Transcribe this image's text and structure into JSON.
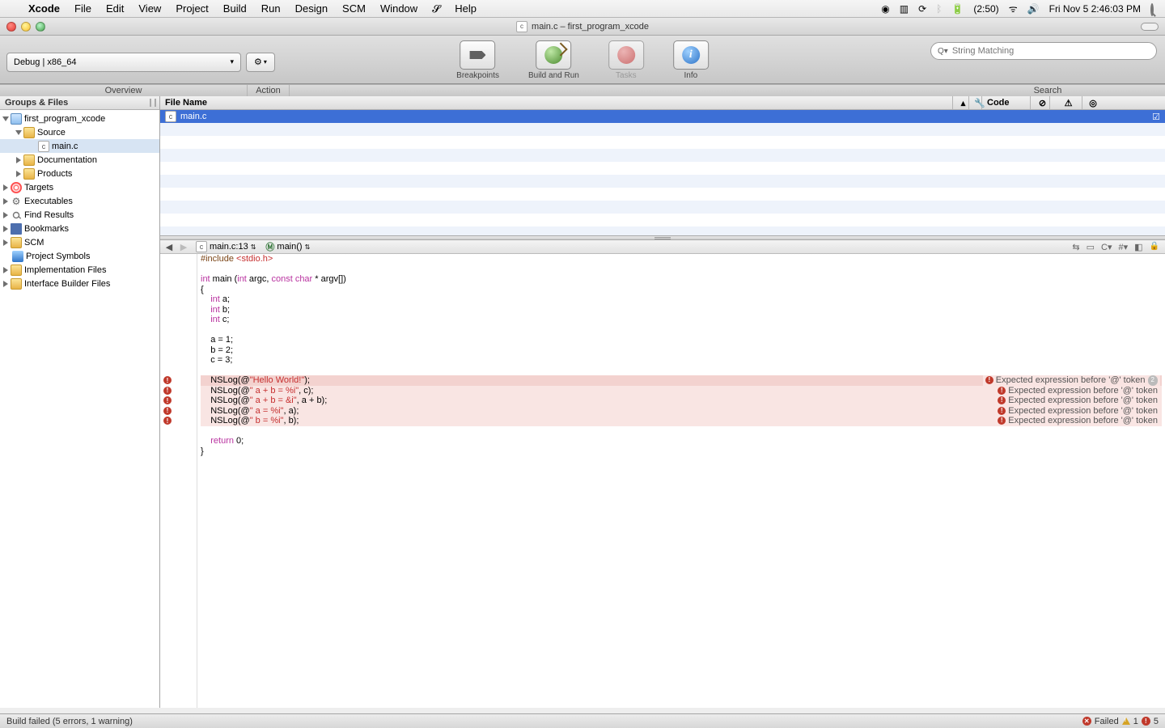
{
  "menubar": {
    "app": "Xcode",
    "items": [
      "File",
      "Edit",
      "View",
      "Project",
      "Build",
      "Run",
      "Design",
      "SCM",
      "Window"
    ],
    "help": "Help",
    "battery": "(2:50)",
    "datetime": "Fri Nov 5  2:46:03 PM"
  },
  "window": {
    "title": "main.c – first_program_xcode",
    "file_icon_letter": "c"
  },
  "toolbar": {
    "config": "Debug | x86_64",
    "overview": "Overview",
    "action": "Action",
    "breakpoints": "Breakpoints",
    "build_run": "Build and Run",
    "tasks": "Tasks",
    "info": "Info",
    "search_label": "Search",
    "search_placeholder": "String Matching"
  },
  "sidebar": {
    "header": "Groups & Files",
    "nodes": [
      {
        "indent": 0,
        "tri": "open",
        "icon": "proj",
        "label": "first_program_xcode"
      },
      {
        "indent": 1,
        "tri": "open",
        "icon": "folder",
        "label": "Source"
      },
      {
        "indent": 2,
        "tri": "none",
        "icon": "cfile",
        "label": "main.c",
        "selected": true,
        "icon_letter": "c"
      },
      {
        "indent": 1,
        "tri": "closed",
        "icon": "folder",
        "label": "Documentation"
      },
      {
        "indent": 1,
        "tri": "closed",
        "icon": "folder",
        "label": "Products"
      },
      {
        "indent": 0,
        "tri": "closed",
        "icon": "target",
        "label": "Targets"
      },
      {
        "indent": 0,
        "tri": "closed",
        "icon": "gear2",
        "label": "Executables"
      },
      {
        "indent": 0,
        "tri": "closed",
        "icon": "mag",
        "label": "Find Results"
      },
      {
        "indent": 0,
        "tri": "closed",
        "icon": "book",
        "label": "Bookmarks"
      },
      {
        "indent": 0,
        "tri": "closed",
        "icon": "folder",
        "label": "SCM"
      },
      {
        "indent": 0,
        "tri": "none",
        "icon": "cube",
        "label": "Project Symbols"
      },
      {
        "indent": 0,
        "tri": "closed",
        "icon": "folder",
        "label": "Implementation Files"
      },
      {
        "indent": 0,
        "tri": "closed",
        "icon": "folder",
        "label": "Interface Builder Files"
      }
    ]
  },
  "file_list": {
    "columns": {
      "name": "File Name",
      "code": "Code"
    },
    "rows": [
      {
        "icon_letter": "c",
        "name": "main.c",
        "selected": true
      }
    ]
  },
  "nav": {
    "file": "main.c:13",
    "func": "main()"
  },
  "code": {
    "lines": [
      {
        "t": "pp",
        "c": "#include <stdio.h>"
      },
      {
        "t": "",
        "c": ""
      },
      {
        "t": "sig",
        "c": "int main (int argc, const char * argv[])"
      },
      {
        "t": "",
        "c": "{"
      },
      {
        "t": "decl",
        "c": "    int a;"
      },
      {
        "t": "decl",
        "c": "    int b;"
      },
      {
        "t": "decl",
        "c": "    int c;"
      },
      {
        "t": "",
        "c": "    "
      },
      {
        "t": "",
        "c": "    a = 1;"
      },
      {
        "t": "",
        "c": "    b = 2;"
      },
      {
        "t": "",
        "c": "    c = 3;"
      },
      {
        "t": "",
        "c": "    "
      },
      {
        "t": "log",
        "c": "    NSLog(@\"Hello World!\");",
        "err": "Expected expression before '@' token",
        "err_n": 2
      },
      {
        "t": "log",
        "c": "    NSLog(@\" a + b = %i\", c);",
        "err": "Expected expression before '@' token"
      },
      {
        "t": "log",
        "c": "    NSLog(@\" a + b = &i\", a + b);",
        "err": "Expected expression before '@' token"
      },
      {
        "t": "log",
        "c": "    NSLog(@\" a = %i\", a);",
        "err": "Expected expression before '@' token"
      },
      {
        "t": "log",
        "c": "    NSLog(@\" b = %i\", b);",
        "err": "Expected expression before '@' token"
      },
      {
        "t": "",
        "c": "    "
      },
      {
        "t": "ret",
        "c": "    return 0;"
      },
      {
        "t": "",
        "c": "}"
      }
    ]
  },
  "status": {
    "msg": "Build failed (5 errors, 1 warning)",
    "failed": "Failed",
    "warn_n": "1",
    "err_n": "5"
  }
}
